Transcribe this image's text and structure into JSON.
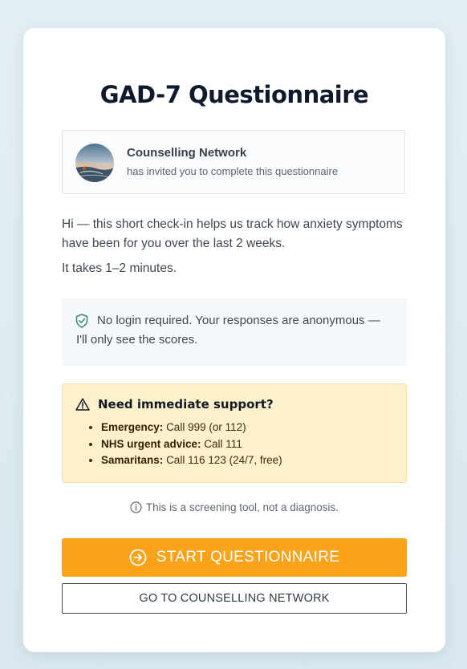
{
  "title": "GAD-7 Questionnaire",
  "inviter": {
    "name": "Counselling Network",
    "subtitle": "has invited you to complete this questionnaire",
    "avatar_icon": "landscape-avatar"
  },
  "intro": {
    "text": "Hi — this short check-in helps us track how anxiety symptoms have been for you over the last 2 weeks.",
    "duration": "It takes 1–2 minutes."
  },
  "privacy": {
    "icon": "shield-check-icon",
    "text": "No login required. Your responses are anonymous — I'll only see the scores."
  },
  "support": {
    "icon": "warning-icon",
    "title": "Need immediate support?",
    "items": [
      {
        "label": "Emergency:",
        "value": "Call 999 (or 112)"
      },
      {
        "label": "NHS urgent advice:",
        "value": "Call 111"
      },
      {
        "label": "Samaritans:",
        "value": "Call 116 123 (24/7, free)"
      }
    ]
  },
  "disclaimer": {
    "icon": "info-icon",
    "text": "This is a screening tool, not a diagnosis."
  },
  "actions": {
    "start_label": "START QUESTIONNAIRE",
    "start_icon": "arrow-circle-right-icon",
    "network_label": "GO TO COUNSELLING NETWORK"
  },
  "colors": {
    "primary": "#fba21b",
    "alert_bg": "#fdf1cc",
    "shield": "#2e8b6a",
    "title": "#0f1b2d"
  }
}
